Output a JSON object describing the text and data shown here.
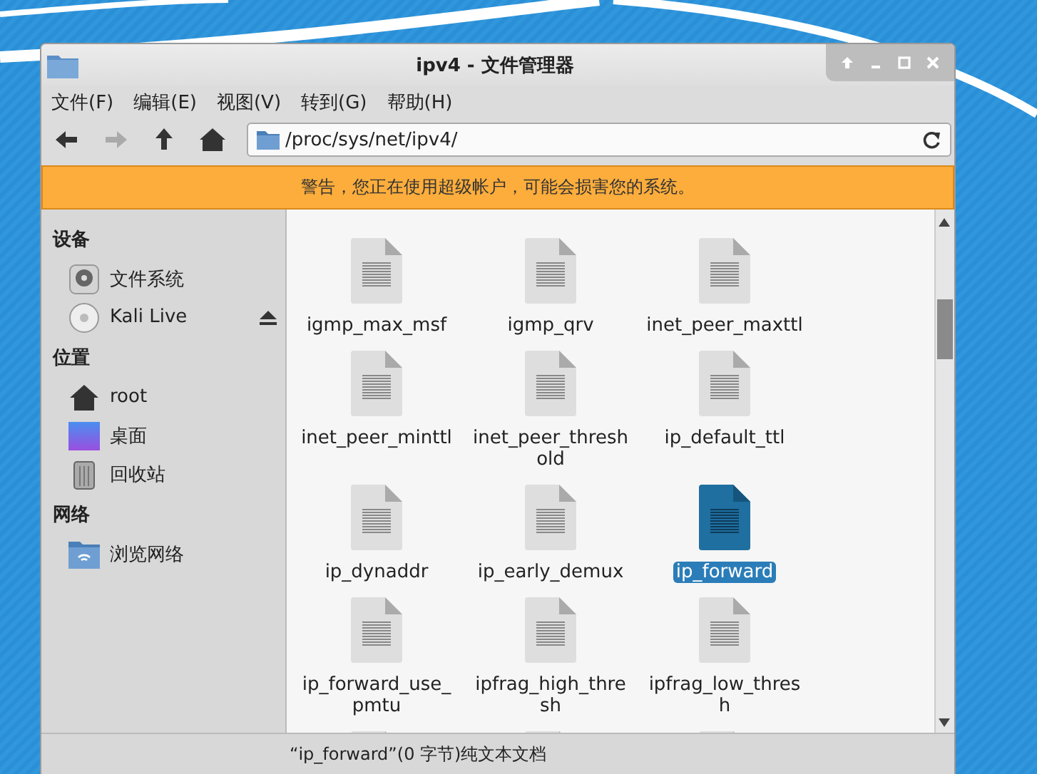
{
  "window": {
    "title": "ipv4 - 文件管理器"
  },
  "menu": [
    "文件(F)",
    "编辑(E)",
    "视图(V)",
    "转到(G)",
    "帮助(H)"
  ],
  "toolbar": [
    {
      "kind": "back",
      "disabled": false
    },
    {
      "kind": "forward",
      "disabled": true
    },
    {
      "kind": "up",
      "disabled": false
    },
    {
      "kind": "home",
      "disabled": false
    }
  ],
  "location": {
    "value": "/proc/sys/net/ipv4/"
  },
  "warning": "警告，您正在使用超级帐户，可能会损害您的系统。",
  "sidebar": [
    {
      "title": "设备",
      "items": [
        {
          "label": "文件系统",
          "kind": "drive",
          "eject": false
        },
        {
          "label": "Kali Live",
          "kind": "disc",
          "eject": true
        }
      ]
    },
    {
      "title": "位置",
      "items": [
        {
          "label": "root",
          "kind": "home",
          "eject": false
        },
        {
          "label": "桌面",
          "kind": "desktop",
          "eject": false
        },
        {
          "label": "回收站",
          "kind": "trash",
          "eject": false
        }
      ]
    },
    {
      "title": "网络",
      "items": [
        {
          "label": "浏览网络",
          "kind": "network",
          "eject": false
        }
      ]
    }
  ],
  "files": [
    {
      "name": "igmp_max_msf",
      "selected": false
    },
    {
      "name": "igmp_qrv",
      "selected": false
    },
    {
      "name": "inet_peer_maxttl",
      "selected": false
    },
    {
      "name": "inet_peer_minttl",
      "selected": false
    },
    {
      "name": "inet_peer_threshold",
      "selected": false
    },
    {
      "name": "ip_default_ttl",
      "selected": false
    },
    {
      "name": "ip_dynaddr",
      "selected": false
    },
    {
      "name": "ip_early_demux",
      "selected": false
    },
    {
      "name": "ip_forward",
      "selected": true
    },
    {
      "name": "ip_forward_use_pmtu",
      "selected": false
    },
    {
      "name": "ipfrag_high_thresh",
      "selected": false
    },
    {
      "name": "ipfrag_low_thresh",
      "selected": false
    }
  ],
  "status_bar": "“ip_forward”(0 字节)纯文本文档"
}
